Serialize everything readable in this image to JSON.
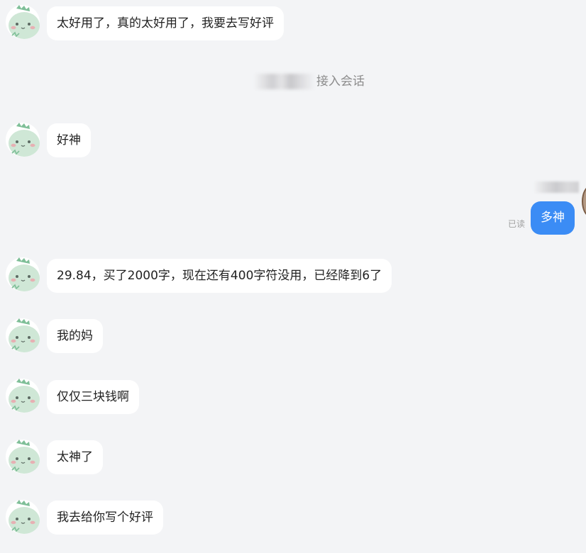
{
  "messages": [
    {
      "from": "other",
      "text": "太好用了，真的太好用了，我要去写好评"
    },
    {
      "from": "other",
      "text": "好神"
    },
    {
      "from": "other",
      "text": "29.84，买了2000字，现在还有400字符没用，已经降到6了"
    },
    {
      "from": "other",
      "text": "我的妈"
    },
    {
      "from": "other",
      "text": "仅仅三块钱啊"
    },
    {
      "from": "other",
      "text": "太神了"
    },
    {
      "from": "other",
      "text": "我去给你写个好评"
    }
  ],
  "system_notice": {
    "text": "接入会话"
  },
  "my_message": {
    "text": "多神",
    "status": "已读"
  },
  "colors": {
    "background": "#f3f4f6",
    "bubble_other": "#ffffff",
    "bubble_me": "#3b8cf5",
    "avatar_face": "#cfe7d6"
  },
  "icons": {
    "other_avatar": "green-dinosaur-avatar-icon",
    "my_avatar": "user-avatar"
  }
}
